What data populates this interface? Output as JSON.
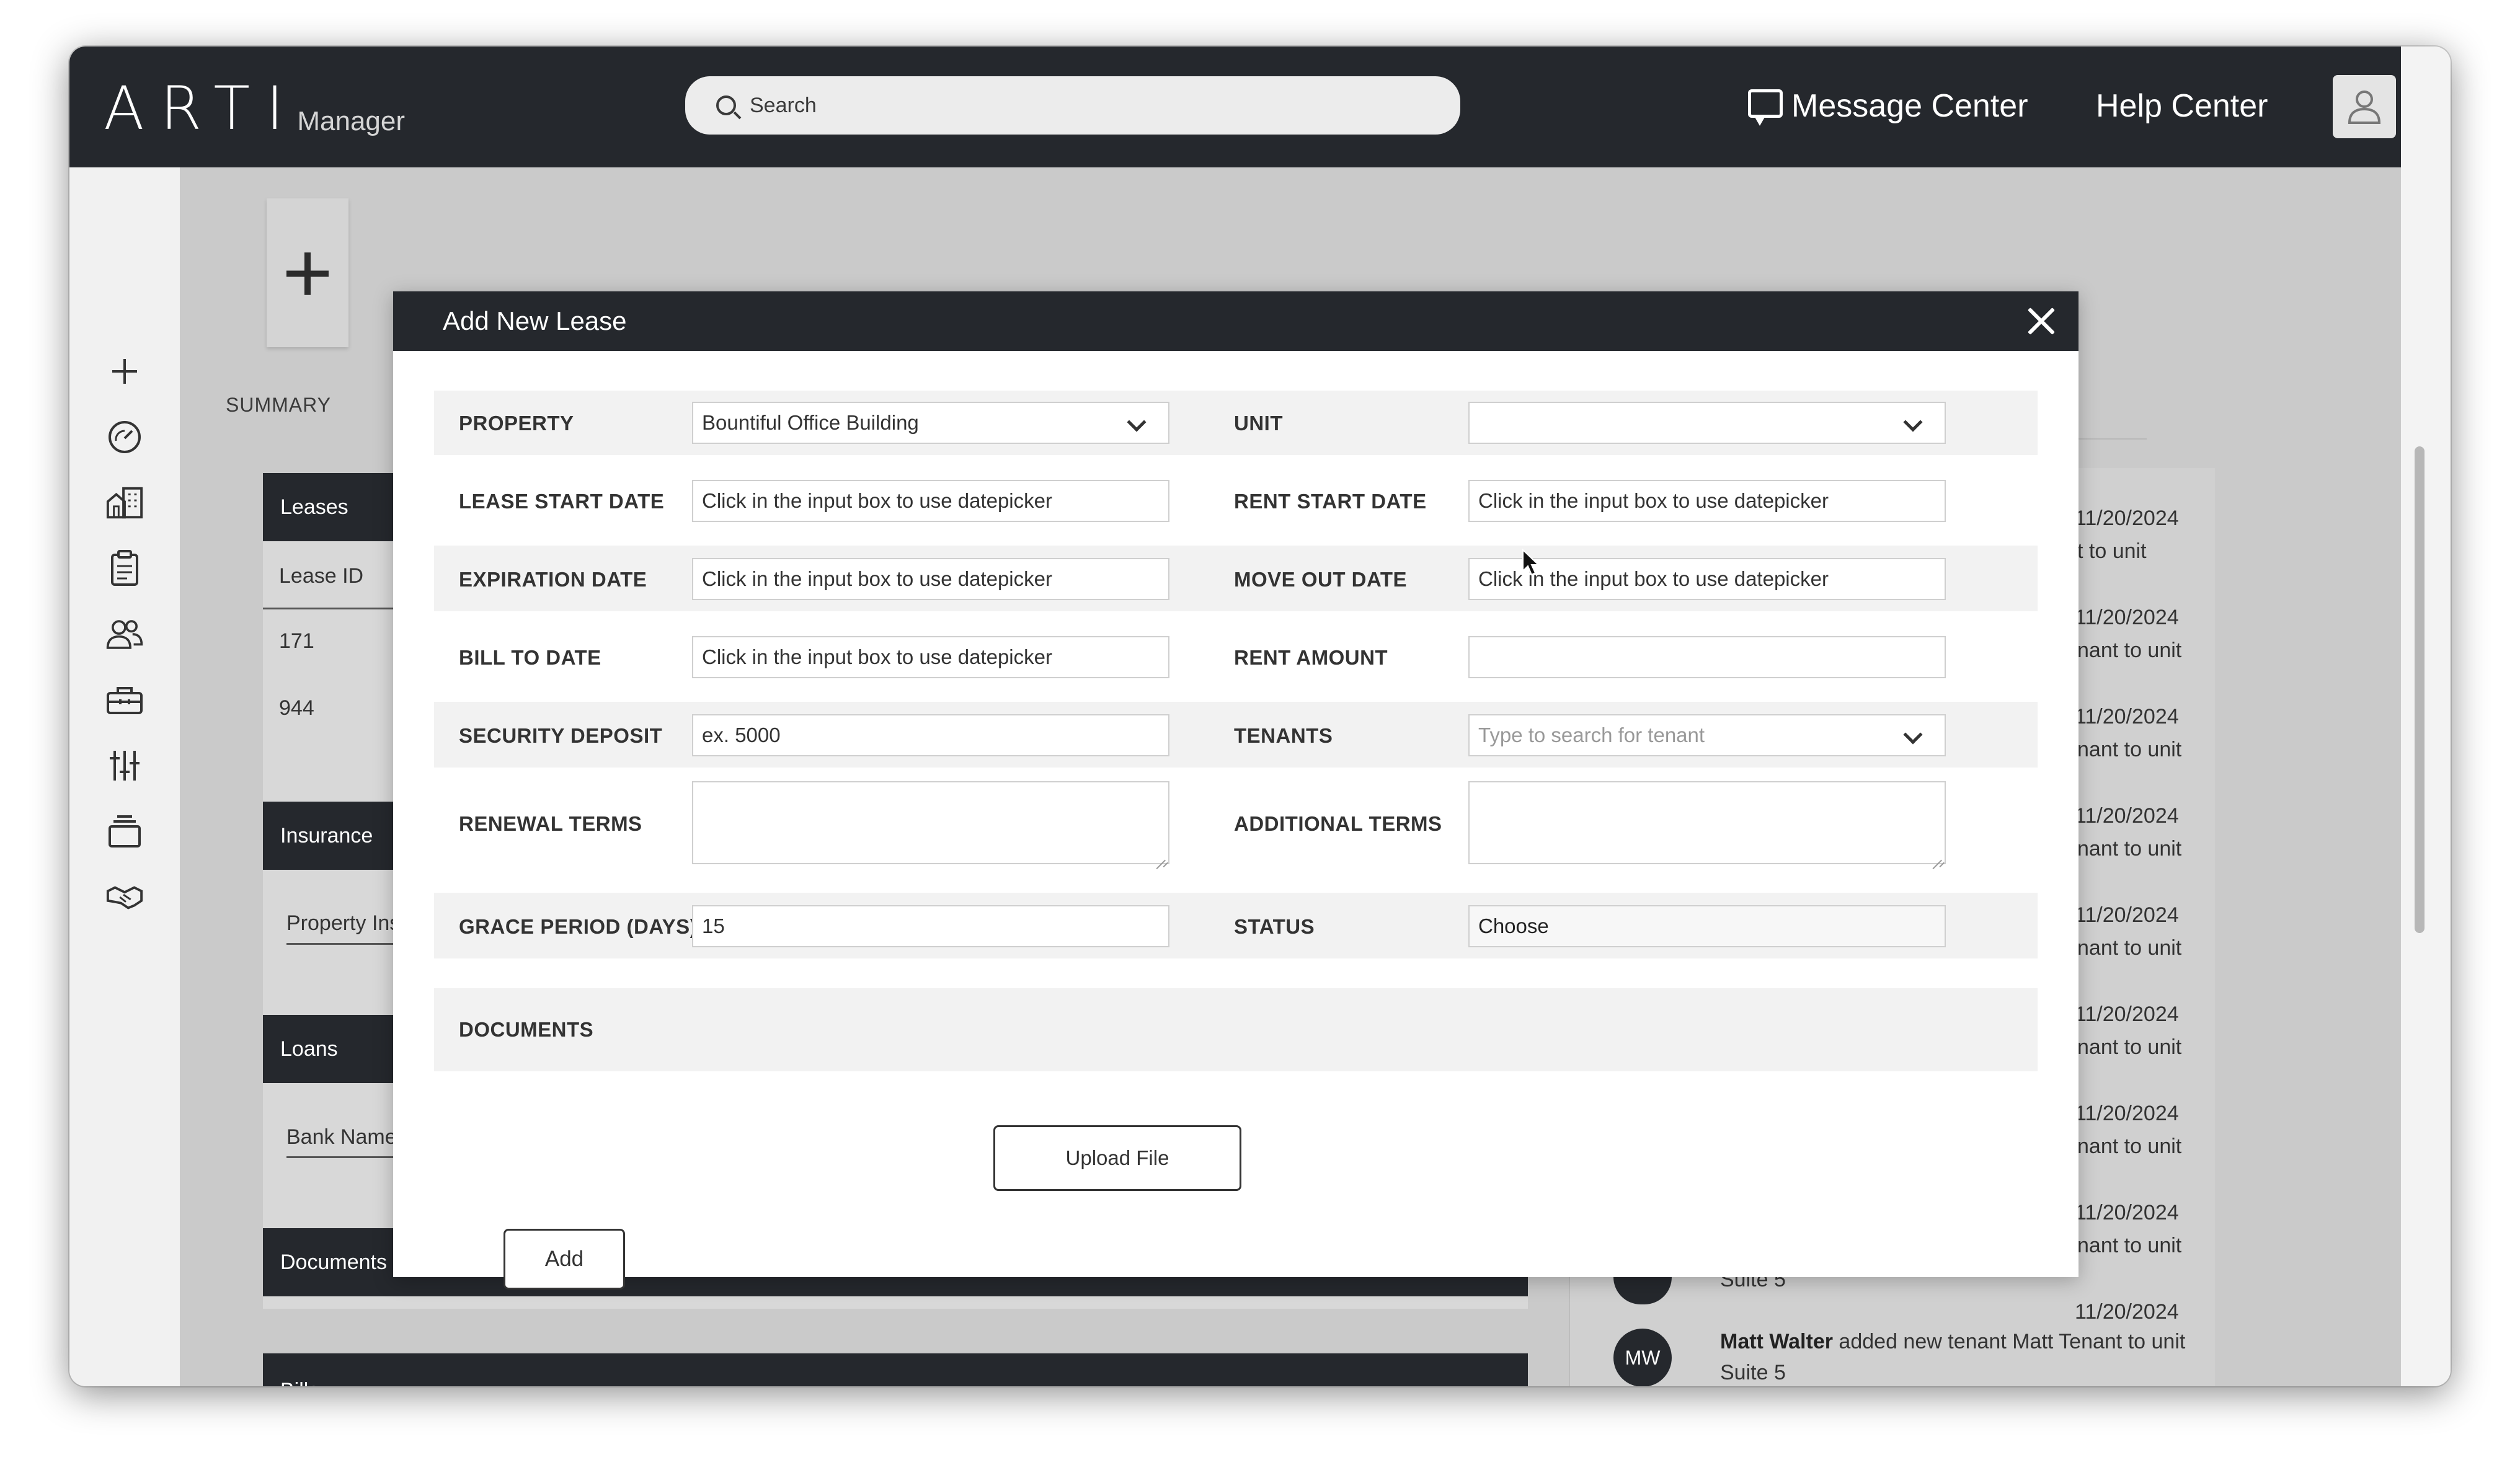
{
  "app": {
    "logo_main": "ARTI",
    "logo_sub": "Manager"
  },
  "topbar": {
    "search_placeholder": "Search",
    "message_center": "Message Center",
    "help_center": "Help Center"
  },
  "sidebar": {
    "icons": [
      "plus-icon",
      "dashboard-icon",
      "buildings-icon",
      "clipboard-icon",
      "users-icon",
      "toolbox-icon",
      "sliders-icon",
      "stack-icon",
      "handshake-icon"
    ]
  },
  "background": {
    "summary_label": "SUMMARY",
    "leases_header": "Leases",
    "lease_id_label": "Lease ID",
    "lease_rows": [
      "171",
      "944"
    ],
    "insurance_header": "Insurance",
    "insurance_field": "Property Ins",
    "loans_header": "Loans",
    "loans_field": "Bank Name",
    "documents_header": "Documents",
    "bills_header": "Bills",
    "activity_dates": [
      "11/20/2024",
      "11/20/2024",
      "11/20/2024",
      "11/20/2024",
      "11/20/2024",
      "11/20/2024",
      "11/20/2024",
      "11/20/2024",
      "11/20/2024"
    ],
    "activity_snippets": [
      "t to unit",
      "nant to unit",
      "nant to unit",
      "nant to unit",
      "nant to unit",
      "nant to unit",
      "nant to unit",
      "nant to unit"
    ],
    "activity_suite_partial": "Suite 5",
    "activity_last": {
      "initials": "MW",
      "name": "Matt Walter",
      "text": " added new tenant Matt Tenant to unit",
      "suite": "Suite 5"
    }
  },
  "modal": {
    "title": "Add New Lease",
    "fields": {
      "property_label": "PROPERTY",
      "property_value": "Bountiful Office Building",
      "unit_label": "UNIT",
      "unit_value": "",
      "lease_start_label": "LEASE START DATE",
      "lease_start_placeholder": "Click in the input box to use datepicker",
      "rent_start_label": "RENT START DATE",
      "rent_start_placeholder": "Click in the input box to use datepicker",
      "expiration_label": "EXPIRATION DATE",
      "expiration_placeholder": "Click in the input box to use datepicker",
      "move_out_label": "MOVE OUT DATE",
      "move_out_placeholder": "Click in the input box to use datepicker",
      "bill_to_label": "BILL TO DATE",
      "bill_to_placeholder": "Click in the input box to use datepicker",
      "rent_amount_label": "RENT AMOUNT",
      "rent_amount_value": "",
      "security_deposit_label": "SECURITY DEPOSIT",
      "security_deposit_value": "ex. 5000",
      "tenants_label": "TENANTS",
      "tenants_placeholder": "Type to search for tenant",
      "renewal_terms_label": "RENEWAL TERMS",
      "additional_terms_label": "ADDITIONAL TERMS",
      "grace_period_label": "GRACE PERIOD (DAYS)",
      "grace_period_value": "15",
      "status_label": "STATUS",
      "status_value": "Choose",
      "documents_label": "DOCUMENTS"
    },
    "upload_button": "Upload File",
    "add_button": "Add"
  }
}
